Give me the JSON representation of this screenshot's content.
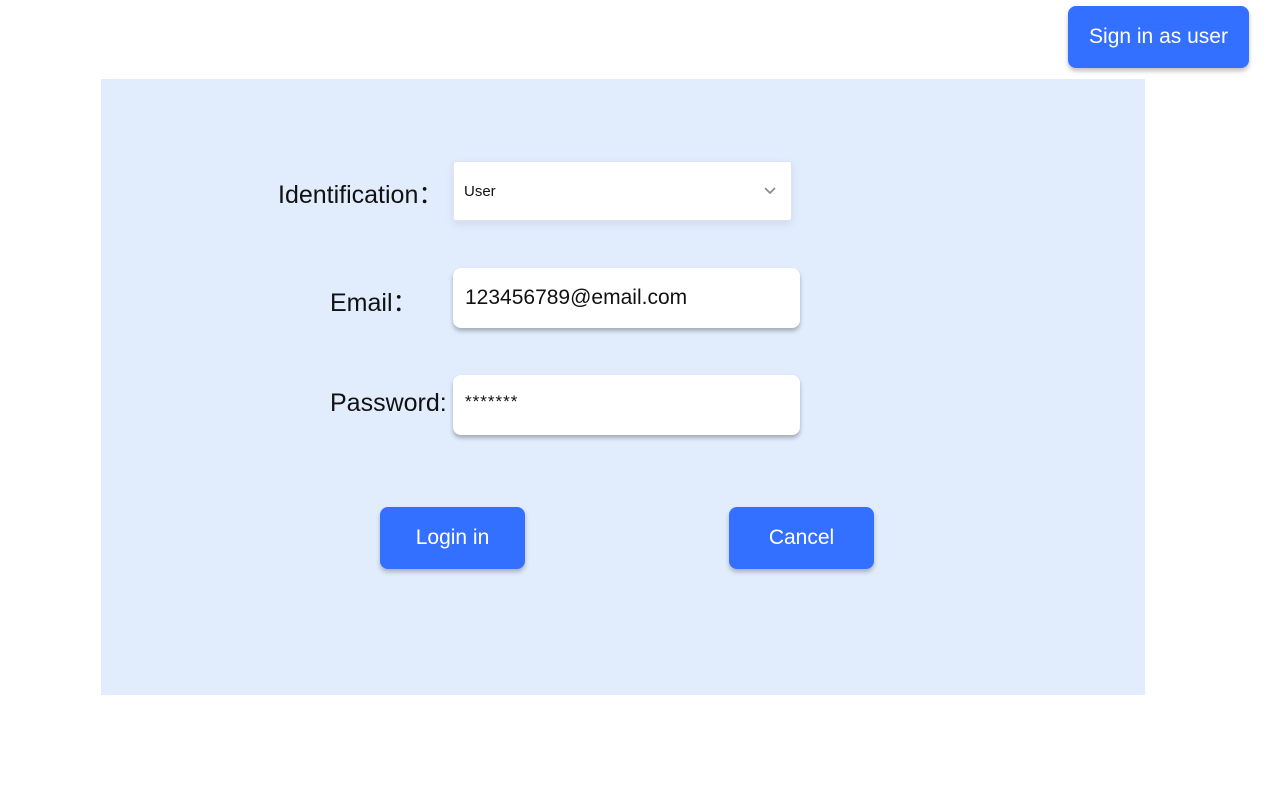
{
  "header": {
    "sign_in_user_label": "Sign in as user"
  },
  "form": {
    "identification_label": "Identification：",
    "identification_value": "User",
    "email_label": "Email：",
    "email_value": "123456789@email.com",
    "password_label": "Password:",
    "password_value": "*******",
    "login_label": "Login in",
    "cancel_label": "Cancel"
  },
  "icons": {
    "dropdown": "chevron-down-icon"
  },
  "colors": {
    "accent": "#3370ff",
    "panel_background": "#e1edfd",
    "page_background": "#ffffff"
  }
}
